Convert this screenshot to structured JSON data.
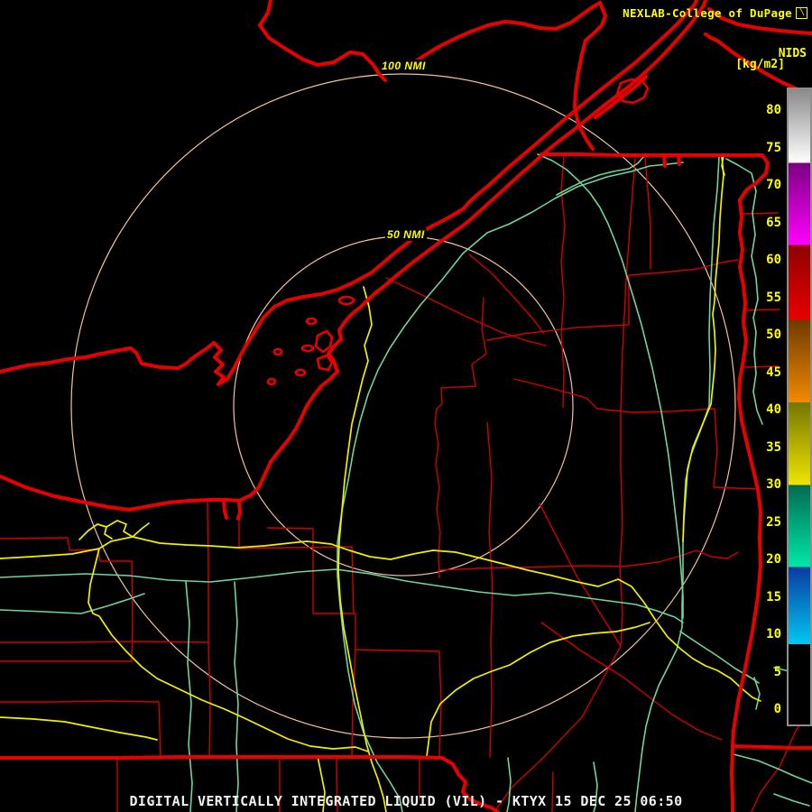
{
  "header": {
    "title": "NEXLAB-College of DuPage",
    "logo_icon_glyph": "╲"
  },
  "colorbar": {
    "product_label": "NIDS",
    "units_label": "[kg/m2]",
    "ticks": [
      80,
      75,
      70,
      65,
      60,
      55,
      50,
      45,
      40,
      35,
      30,
      25,
      20,
      15,
      10,
      5,
      0
    ],
    "value_top": 82.8,
    "value_bottom": -2.0,
    "segments": [
      {
        "from": 82.8,
        "to": 73,
        "top_color": "#8a8a8a",
        "bottom_color": "#ffffff"
      },
      {
        "from": 73,
        "to": 62,
        "top_color": "#7a0080",
        "bottom_color": "#ff00ff"
      },
      {
        "from": 62,
        "to": 52,
        "top_color": "#8f0000",
        "bottom_color": "#e80000"
      },
      {
        "from": 52,
        "to": 41,
        "top_color": "#6f3a00",
        "bottom_color": "#f08a00"
      },
      {
        "from": 41,
        "to": 30,
        "top_color": "#767600",
        "bottom_color": "#f0e400"
      },
      {
        "from": 30,
        "to": 19,
        "top_color": "#006b50",
        "bottom_color": "#00e8a8"
      },
      {
        "from": 19,
        "to": 8.7,
        "top_color": "#0b3aa0",
        "bottom_color": "#00c8f2"
      },
      {
        "from": 8.7,
        "to": -2,
        "top_color": "#000000",
        "bottom_color": "#000000"
      }
    ],
    "frame_color": "#8f8f8f"
  },
  "range_rings": {
    "labels": [
      {
        "text": "100 NMI"
      },
      {
        "text": "50 NMI"
      }
    ],
    "color": "#f2c2a0"
  },
  "caption": {
    "text": "DIGITAL VERTICALLY INTEGRATED LIQUID (VIL) - KTYX 15 DEC 25 06:50"
  },
  "colors": {
    "label_yellow": "#ffff00",
    "state_water_red": "#e80000",
    "county_red": "#cf0000",
    "road_yellow": "#f0f000",
    "road_green": "#72d49a",
    "ring_peach": "#f2c2a0",
    "caption_white": "#f2f2f2",
    "background": "#000000"
  }
}
